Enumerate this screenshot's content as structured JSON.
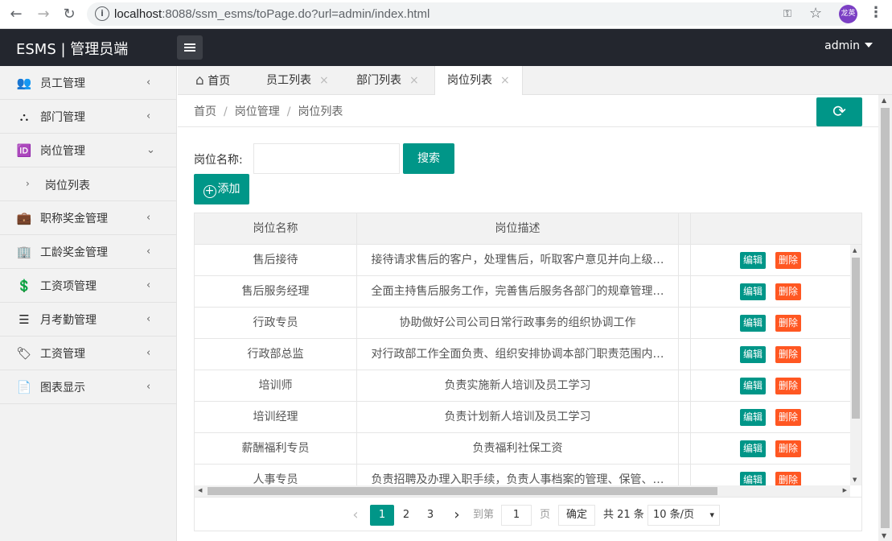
{
  "browser": {
    "url_host": "localhost",
    "url_rest": ":8088/ssm_esms/toPage.do?url=admin/index.html",
    "profile_initials": "龙英"
  },
  "header": {
    "brand": "ESMS | 管理员端",
    "user": "admin"
  },
  "sidebar": {
    "items": [
      {
        "label": "员工管理",
        "icon": "users-icon",
        "glyph": "👥",
        "arrow": "‹"
      },
      {
        "label": "部门管理",
        "icon": "sitemap-icon",
        "glyph": "⛬",
        "arrow": "‹"
      },
      {
        "label": "岗位管理",
        "icon": "id-card-icon",
        "glyph": "🆔",
        "arrow": "⌄"
      },
      {
        "label": "职称奖金管理",
        "icon": "briefcase-icon",
        "glyph": "💼",
        "arrow": "‹"
      },
      {
        "label": "工龄奖金管理",
        "icon": "building-icon",
        "glyph": "🏢",
        "arrow": "‹"
      },
      {
        "label": "工资项管理",
        "icon": "money-window-icon",
        "glyph": "💲",
        "arrow": "‹"
      },
      {
        "label": "月考勤管理",
        "icon": "layers-icon",
        "glyph": "☰",
        "arrow": "‹"
      },
      {
        "label": "工资管理",
        "icon": "tag-icon",
        "glyph": "🏷",
        "arrow": "‹"
      },
      {
        "label": "图表显示",
        "icon": "document-icon",
        "glyph": "📄",
        "arrow": "‹"
      }
    ],
    "sub_item": {
      "label": "岗位列表",
      "arrow": "›"
    }
  },
  "tabs": [
    {
      "label": "首页",
      "icon": "home-icon",
      "glyph": "⌂"
    },
    {
      "label": "员工列表",
      "close": "×"
    },
    {
      "label": "部门列表",
      "close": "×"
    },
    {
      "label": "岗位列表",
      "close": "×"
    }
  ],
  "breadcrumb": {
    "items": [
      "首页",
      "岗位管理",
      "岗位列表"
    ],
    "sep": "/"
  },
  "refresh_glyph": "⟳",
  "search": {
    "label": "岗位名称:",
    "value": "",
    "button": "搜索"
  },
  "add_button": {
    "plus": "+",
    "label": "添加"
  },
  "table": {
    "headers": [
      "岗位名称",
      "岗位描述",
      ""
    ],
    "edit_label": "编辑",
    "delete_label": "删除",
    "rows": [
      {
        "name": "售后接待",
        "desc": "接待请求售后的客户，处理售后，听取客户意见并向上级…"
      },
      {
        "name": "售后服务经理",
        "desc": "全面主持售后服务工作，完善售后服务各部门的规章管理…"
      },
      {
        "name": "行政专员",
        "desc": "协助做好公司公司日常行政事务的组织协调工作"
      },
      {
        "name": "行政部总监",
        "desc": "对行政部工作全面负责、组织安排协调本部门职责范围内…"
      },
      {
        "name": "培训师",
        "desc": "负责实施新人培训及员工学习"
      },
      {
        "name": "培训经理",
        "desc": "负责计划新人培训及员工学习"
      },
      {
        "name": "薪酬福利专员",
        "desc": "负责福利社保工资"
      },
      {
        "name": "人事专员",
        "desc": "负责招聘及办理入职手续，负责人事档案的管理、保管、…"
      }
    ]
  },
  "pager": {
    "prev": "‹",
    "pages": [
      "1",
      "2",
      "3"
    ],
    "next": "›",
    "goto_label": "到第",
    "goto_value": "1",
    "page_unit": "页",
    "confirm": "确定",
    "total": "共 21 条",
    "per_page": "10 条/页"
  }
}
